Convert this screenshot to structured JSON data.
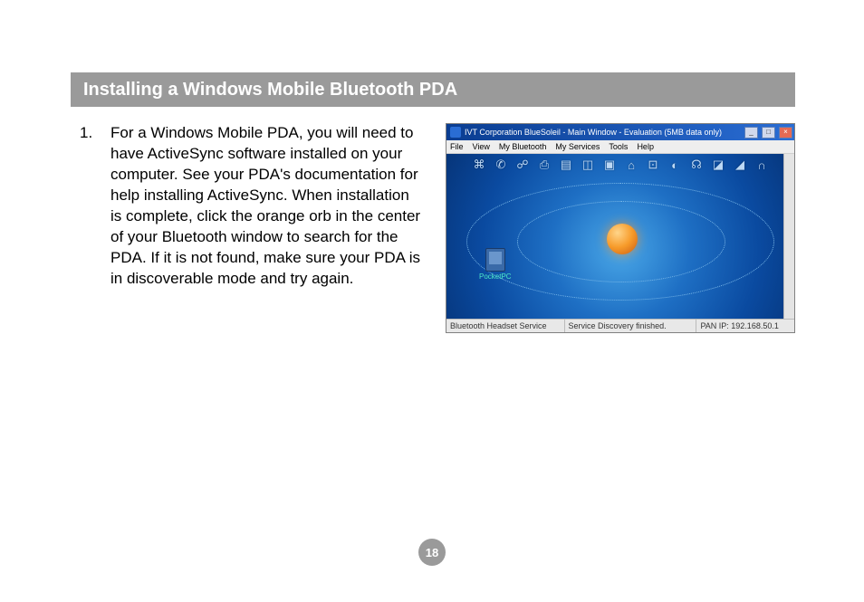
{
  "header": {
    "title": "Installing a Windows Mobile Bluetooth PDA"
  },
  "step": {
    "number": "1.",
    "text": "For a Windows Mobile PDA, you will need to have ActiveSync software installed on your computer.  See your PDA's documentation for help installing ActiveSync.  When installation is complete, click the orange orb in the center of your Bluetooth window to search for the PDA.  If it is not found, make sure your PDA is in discoverable mode and try again."
  },
  "app": {
    "title": "IVT Corporation BlueSoleil - Main Window - Evaluation (5MB data only)",
    "menu": [
      "File",
      "View",
      "My Bluetooth",
      "My Services",
      "Tools",
      "Help"
    ],
    "device_label": "PocketPC",
    "status": {
      "left": "Bluetooth Headset Service",
      "mid": "Service Discovery finished.",
      "right": "PAN IP: 192.168.50.1"
    },
    "icons": [
      "fax-icon",
      "dun-icon",
      "sync-icon",
      "print-icon",
      "pim-icon",
      "oop-icon",
      "ftp-icon",
      "lan-icon",
      "serial-icon",
      "hid-icon",
      "av-icon",
      "imaging-icon",
      "audio-icon",
      "headset-icon"
    ]
  },
  "page_number": "18"
}
